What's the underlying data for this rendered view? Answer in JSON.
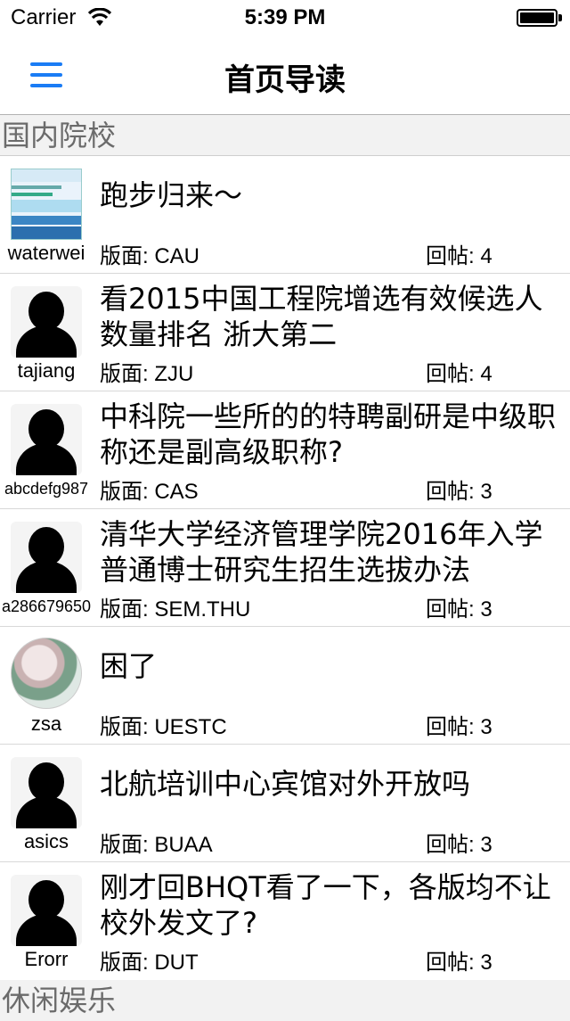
{
  "status_bar": {
    "carrier": "Carrier",
    "time": "5:39 PM"
  },
  "nav": {
    "title": "首页导读"
  },
  "sections": [
    {
      "title": "国内院校"
    },
    {
      "title": "休闲娱乐"
    }
  ],
  "labels": {
    "board_prefix": "版面: ",
    "reply_prefix": "回帖: "
  },
  "posts": [
    {
      "title": "跑步归来～",
      "user": "waterwei",
      "board": "版面: CAU",
      "replies": "回帖: 4",
      "avatar": "board-image"
    },
    {
      "title": "看2015中国工程院增选有效候选人数量排名 浙大第二",
      "user": "tajiang",
      "board": "版面: ZJU",
      "replies": "回帖: 4",
      "avatar": "default-silhouette"
    },
    {
      "title": "中科院一些所的的特聘副研是中级职称还是副高级职称?",
      "user": "abcdefg987",
      "board": "版面: CAS",
      "replies": "回帖: 3",
      "avatar": "default-silhouette"
    },
    {
      "title": "清华大学经济管理学院2016年入学普通博士研究生招生选拔办法",
      "user": "a286679650",
      "board": "版面: SEM.THU",
      "replies": "回帖: 3",
      "avatar": "default-silhouette"
    },
    {
      "title": "困了",
      "user": "zsa",
      "board": "版面: UESTC",
      "replies": "回帖: 3",
      "avatar": "opera-portrait"
    },
    {
      "title": "北航培训中心宾馆对外开放吗",
      "user": "asics",
      "board": "版面: BUAA",
      "replies": "回帖: 3",
      "avatar": "default-silhouette"
    },
    {
      "title": "刚才回BHQT看了一下，各版均不让校外发文了?",
      "user": "Erorr",
      "board": "版面: DUT",
      "replies": "回帖: 3",
      "avatar": "default-silhouette"
    }
  ]
}
